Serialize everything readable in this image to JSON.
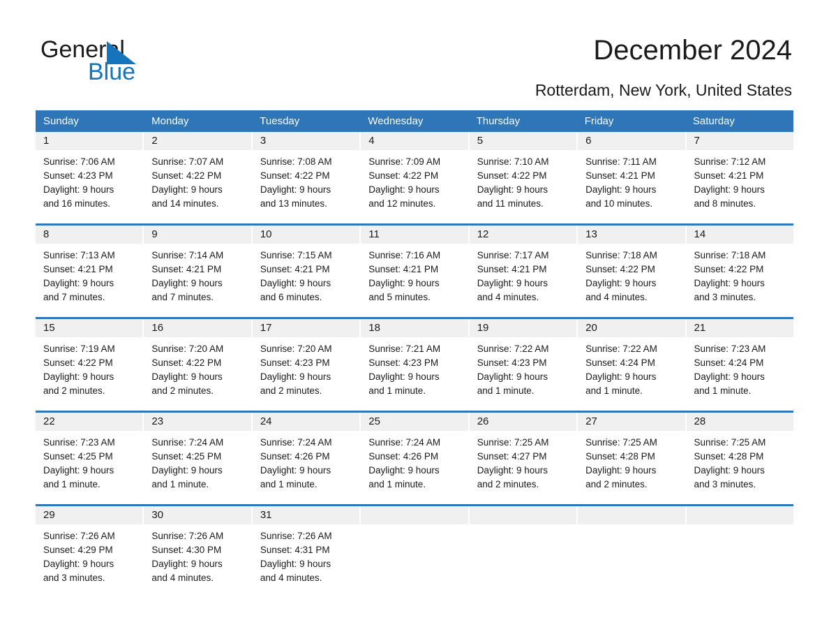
{
  "brand": {
    "name_part1": "General",
    "name_part2": "Blue",
    "accent_color": "#1574bb",
    "triangle_icon": "triangle-icon"
  },
  "header": {
    "month_title": "December 2024",
    "location": "Rotterdam, New York, United States"
  },
  "calendar": {
    "header_bg_color": "#2e76b8",
    "day_band_color": "#f0f0f0",
    "weekdays": [
      "Sunday",
      "Monday",
      "Tuesday",
      "Wednesday",
      "Thursday",
      "Friday",
      "Saturday"
    ],
    "weeks": [
      [
        {
          "day": "1",
          "sunrise": "Sunrise: 7:06 AM",
          "sunset": "Sunset: 4:23 PM",
          "daylight_line1": "Daylight: 9 hours",
          "daylight_line2": "and 16 minutes."
        },
        {
          "day": "2",
          "sunrise": "Sunrise: 7:07 AM",
          "sunset": "Sunset: 4:22 PM",
          "daylight_line1": "Daylight: 9 hours",
          "daylight_line2": "and 14 minutes."
        },
        {
          "day": "3",
          "sunrise": "Sunrise: 7:08 AM",
          "sunset": "Sunset: 4:22 PM",
          "daylight_line1": "Daylight: 9 hours",
          "daylight_line2": "and 13 minutes."
        },
        {
          "day": "4",
          "sunrise": "Sunrise: 7:09 AM",
          "sunset": "Sunset: 4:22 PM",
          "daylight_line1": "Daylight: 9 hours",
          "daylight_line2": "and 12 minutes."
        },
        {
          "day": "5",
          "sunrise": "Sunrise: 7:10 AM",
          "sunset": "Sunset: 4:22 PM",
          "daylight_line1": "Daylight: 9 hours",
          "daylight_line2": "and 11 minutes."
        },
        {
          "day": "6",
          "sunrise": "Sunrise: 7:11 AM",
          "sunset": "Sunset: 4:21 PM",
          "daylight_line1": "Daylight: 9 hours",
          "daylight_line2": "and 10 minutes."
        },
        {
          "day": "7",
          "sunrise": "Sunrise: 7:12 AM",
          "sunset": "Sunset: 4:21 PM",
          "daylight_line1": "Daylight: 9 hours",
          "daylight_line2": "and 8 minutes."
        }
      ],
      [
        {
          "day": "8",
          "sunrise": "Sunrise: 7:13 AM",
          "sunset": "Sunset: 4:21 PM",
          "daylight_line1": "Daylight: 9 hours",
          "daylight_line2": "and 7 minutes."
        },
        {
          "day": "9",
          "sunrise": "Sunrise: 7:14 AM",
          "sunset": "Sunset: 4:21 PM",
          "daylight_line1": "Daylight: 9 hours",
          "daylight_line2": "and 7 minutes."
        },
        {
          "day": "10",
          "sunrise": "Sunrise: 7:15 AM",
          "sunset": "Sunset: 4:21 PM",
          "daylight_line1": "Daylight: 9 hours",
          "daylight_line2": "and 6 minutes."
        },
        {
          "day": "11",
          "sunrise": "Sunrise: 7:16 AM",
          "sunset": "Sunset: 4:21 PM",
          "daylight_line1": "Daylight: 9 hours",
          "daylight_line2": "and 5 minutes."
        },
        {
          "day": "12",
          "sunrise": "Sunrise: 7:17 AM",
          "sunset": "Sunset: 4:21 PM",
          "daylight_line1": "Daylight: 9 hours",
          "daylight_line2": "and 4 minutes."
        },
        {
          "day": "13",
          "sunrise": "Sunrise: 7:18 AM",
          "sunset": "Sunset: 4:22 PM",
          "daylight_line1": "Daylight: 9 hours",
          "daylight_line2": "and 4 minutes."
        },
        {
          "day": "14",
          "sunrise": "Sunrise: 7:18 AM",
          "sunset": "Sunset: 4:22 PM",
          "daylight_line1": "Daylight: 9 hours",
          "daylight_line2": "and 3 minutes."
        }
      ],
      [
        {
          "day": "15",
          "sunrise": "Sunrise: 7:19 AM",
          "sunset": "Sunset: 4:22 PM",
          "daylight_line1": "Daylight: 9 hours",
          "daylight_line2": "and 2 minutes."
        },
        {
          "day": "16",
          "sunrise": "Sunrise: 7:20 AM",
          "sunset": "Sunset: 4:22 PM",
          "daylight_line1": "Daylight: 9 hours",
          "daylight_line2": "and 2 minutes."
        },
        {
          "day": "17",
          "sunrise": "Sunrise: 7:20 AM",
          "sunset": "Sunset: 4:23 PM",
          "daylight_line1": "Daylight: 9 hours",
          "daylight_line2": "and 2 minutes."
        },
        {
          "day": "18",
          "sunrise": "Sunrise: 7:21 AM",
          "sunset": "Sunset: 4:23 PM",
          "daylight_line1": "Daylight: 9 hours",
          "daylight_line2": "and 1 minute."
        },
        {
          "day": "19",
          "sunrise": "Sunrise: 7:22 AM",
          "sunset": "Sunset: 4:23 PM",
          "daylight_line1": "Daylight: 9 hours",
          "daylight_line2": "and 1 minute."
        },
        {
          "day": "20",
          "sunrise": "Sunrise: 7:22 AM",
          "sunset": "Sunset: 4:24 PM",
          "daylight_line1": "Daylight: 9 hours",
          "daylight_line2": "and 1 minute."
        },
        {
          "day": "21",
          "sunrise": "Sunrise: 7:23 AM",
          "sunset": "Sunset: 4:24 PM",
          "daylight_line1": "Daylight: 9 hours",
          "daylight_line2": "and 1 minute."
        }
      ],
      [
        {
          "day": "22",
          "sunrise": "Sunrise: 7:23 AM",
          "sunset": "Sunset: 4:25 PM",
          "daylight_line1": "Daylight: 9 hours",
          "daylight_line2": "and 1 minute."
        },
        {
          "day": "23",
          "sunrise": "Sunrise: 7:24 AM",
          "sunset": "Sunset: 4:25 PM",
          "daylight_line1": "Daylight: 9 hours",
          "daylight_line2": "and 1 minute."
        },
        {
          "day": "24",
          "sunrise": "Sunrise: 7:24 AM",
          "sunset": "Sunset: 4:26 PM",
          "daylight_line1": "Daylight: 9 hours",
          "daylight_line2": "and 1 minute."
        },
        {
          "day": "25",
          "sunrise": "Sunrise: 7:24 AM",
          "sunset": "Sunset: 4:26 PM",
          "daylight_line1": "Daylight: 9 hours",
          "daylight_line2": "and 1 minute."
        },
        {
          "day": "26",
          "sunrise": "Sunrise: 7:25 AM",
          "sunset": "Sunset: 4:27 PM",
          "daylight_line1": "Daylight: 9 hours",
          "daylight_line2": "and 2 minutes."
        },
        {
          "day": "27",
          "sunrise": "Sunrise: 7:25 AM",
          "sunset": "Sunset: 4:28 PM",
          "daylight_line1": "Daylight: 9 hours",
          "daylight_line2": "and 2 minutes."
        },
        {
          "day": "28",
          "sunrise": "Sunrise: 7:25 AM",
          "sunset": "Sunset: 4:28 PM",
          "daylight_line1": "Daylight: 9 hours",
          "daylight_line2": "and 3 minutes."
        }
      ],
      [
        {
          "day": "29",
          "sunrise": "Sunrise: 7:26 AM",
          "sunset": "Sunset: 4:29 PM",
          "daylight_line1": "Daylight: 9 hours",
          "daylight_line2": "and 3 minutes."
        },
        {
          "day": "30",
          "sunrise": "Sunrise: 7:26 AM",
          "sunset": "Sunset: 4:30 PM",
          "daylight_line1": "Daylight: 9 hours",
          "daylight_line2": "and 4 minutes."
        },
        {
          "day": "31",
          "sunrise": "Sunrise: 7:26 AM",
          "sunset": "Sunset: 4:31 PM",
          "daylight_line1": "Daylight: 9 hours",
          "daylight_line2": "and 4 minutes."
        },
        {
          "day": "",
          "sunrise": "",
          "sunset": "",
          "daylight_line1": "",
          "daylight_line2": ""
        },
        {
          "day": "",
          "sunrise": "",
          "sunset": "",
          "daylight_line1": "",
          "daylight_line2": ""
        },
        {
          "day": "",
          "sunrise": "",
          "sunset": "",
          "daylight_line1": "",
          "daylight_line2": ""
        },
        {
          "day": "",
          "sunrise": "",
          "sunset": "",
          "daylight_line1": "",
          "daylight_line2": ""
        }
      ]
    ]
  }
}
